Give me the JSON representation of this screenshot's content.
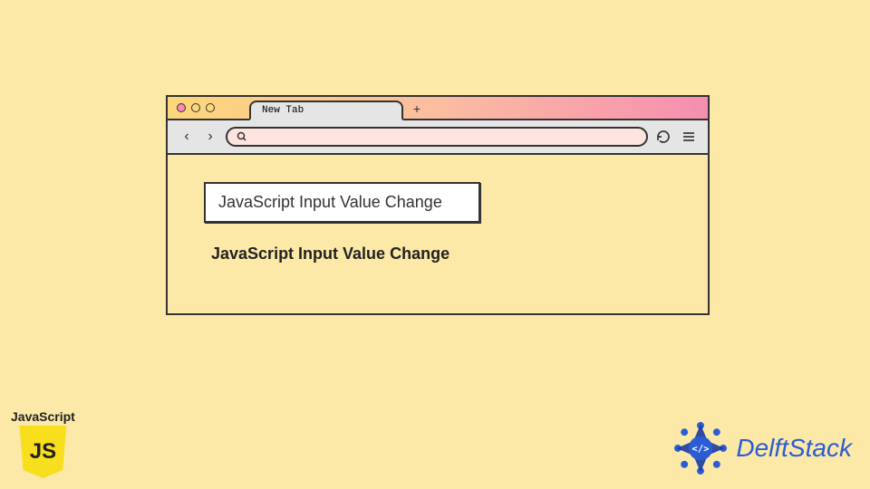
{
  "browser": {
    "tab_label": "New Tab",
    "plus_label": "+",
    "nav_back": "‹",
    "nav_forward": "›"
  },
  "content": {
    "input_value": "JavaScript Input Value Change",
    "output_text": "JavaScript Input Value Change"
  },
  "logos": {
    "js_label": "JavaScript",
    "js_shield": "JS",
    "delft_text": "DelftStack"
  }
}
